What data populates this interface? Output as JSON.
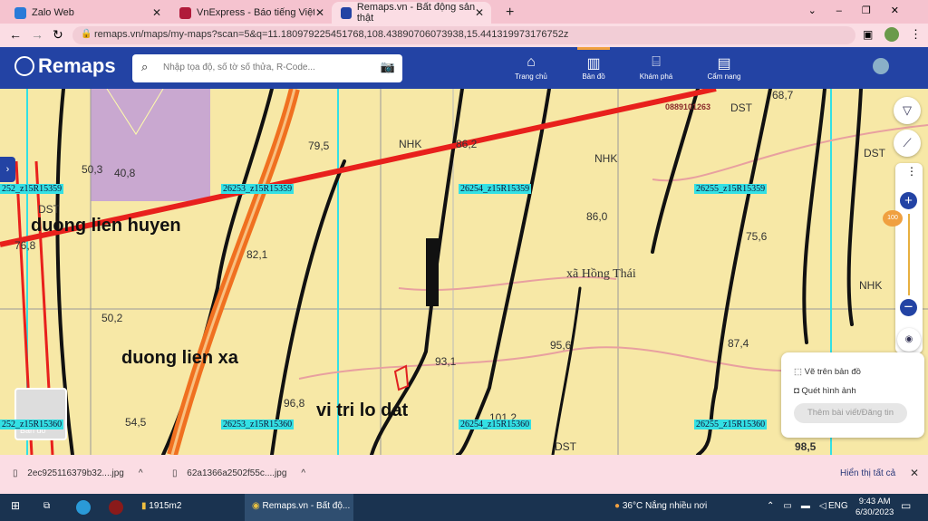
{
  "browser": {
    "tabs": [
      {
        "label": "Zalo Web"
      },
      {
        "label": "VnExpress - Báo tiếng Việt nhiều"
      },
      {
        "label": "Remaps.vn - Bất động sản thật"
      }
    ],
    "new_tab": "+",
    "close": "✕",
    "url": "remaps.vn/maps/my-maps?scan=5&q=11.180979225451768,108.43890706073938,15.441319973176752z"
  },
  "header": {
    "logo": "Remaps",
    "search_placeholder": "Nhập tọa độ, số tờ số thửa, R-Code...",
    "nav": [
      {
        "label": "Trang chủ",
        "icon": "home-icon"
      },
      {
        "label": "Bản đồ",
        "icon": "map-icon"
      },
      {
        "label": "Khám phá",
        "icon": "store-icon"
      },
      {
        "label": "Cẩm nang",
        "icon": "handbook-icon"
      }
    ]
  },
  "map": {
    "labels": [
      "50,3",
      "40,8",
      "79,5",
      "NHK",
      "86,2",
      "NHK",
      "68,7",
      "DST",
      "DST",
      "DST",
      "76,8",
      "82,1",
      "86,0",
      "75,6",
      "xã Hồng Thái",
      "NHK",
      "50,2",
      "93,1",
      "95,6",
      "87,4",
      "96,8",
      "54,5",
      "101,2",
      "DST",
      "98,5",
      "0889101263"
    ],
    "overlay_text": [
      "duong lien huyen",
      "duong lien xa",
      "vi tri lo dat"
    ],
    "parcel_codes": [
      "252_z15R15359",
      "26253_z15R15359",
      "26254_z15R15359",
      "26255_z15R15359",
      "26253_z15R15360",
      "26254_z15R15360",
      "26255_z15R15360",
      "252_z15R15360"
    ],
    "zoom_level": "100",
    "basemap_label": "Bản đồ",
    "colors": {
      "background": "#f7e8a6",
      "grid": "#33e0e4",
      "road_main": "#e8201c",
      "road_secondary": "#f07020",
      "contour": "#111111",
      "parcel_marker": "#e02020"
    }
  },
  "popup": {
    "draw": "Vẽ trên bản đồ",
    "scan": "Quét hình ảnh",
    "post": "Thêm bài viết/Đăng tin"
  },
  "downloads": {
    "items": [
      "2ec925116379b32....jpg",
      "62a1366a2502f55c....jpg"
    ],
    "show_all": "Hiển thị tất cả"
  },
  "taskbar": {
    "folder": "1915m2",
    "chrome": "Remaps.vn - Bất độ...",
    "weather": "36°C  Nắng nhiều nơi",
    "lang": "ENG",
    "time": "9:43 AM",
    "date": "6/30/2023"
  }
}
